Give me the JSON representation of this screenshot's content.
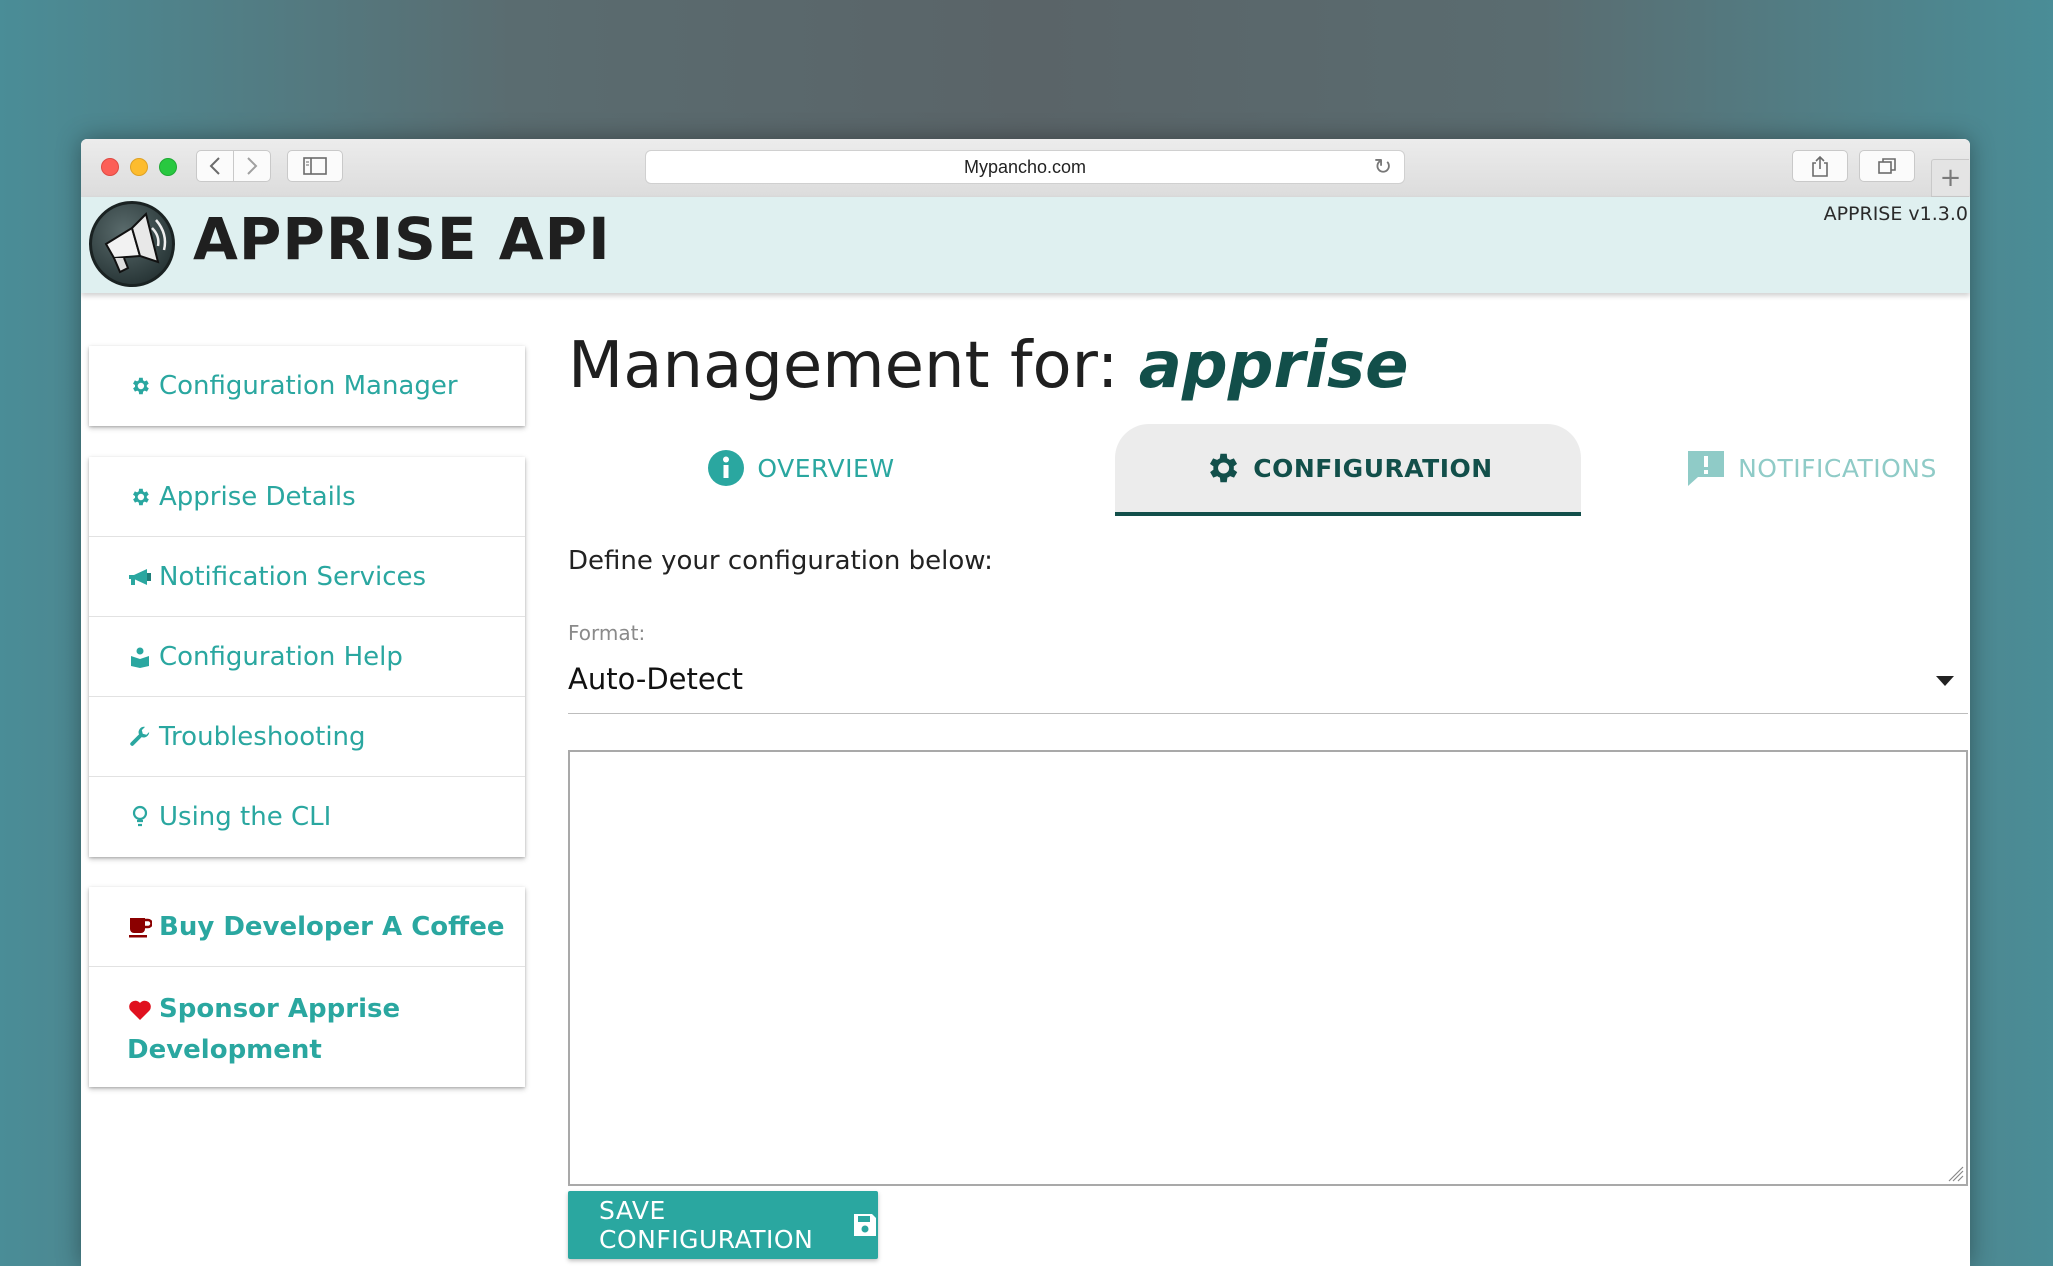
{
  "browser": {
    "url": "Mypancho.com"
  },
  "header": {
    "title": "APPRISE API",
    "version": "APPRISE v1.3.0"
  },
  "sidebar": {
    "top": {
      "label": "Configuration Manager",
      "icon": "gear-icon"
    },
    "items": [
      {
        "label": "Apprise Details",
        "icon": "gear-icon"
      },
      {
        "label": "Notification Services",
        "icon": "megaphone-icon"
      },
      {
        "label": "Configuration Help",
        "icon": "book-reader-icon"
      },
      {
        "label": "Troubleshooting",
        "icon": "wrench-icon"
      },
      {
        "label": "Using the CLI",
        "icon": "lightbulb-icon"
      }
    ],
    "support": [
      {
        "label": "Buy Developer A Coffee",
        "icon": "coffee-icon"
      },
      {
        "label_line1": "Sponsor Apprise",
        "label_line2": "Development",
        "icon": "heart-icon"
      }
    ]
  },
  "main": {
    "heading_prefix": "Management for:",
    "heading_key": "apprise",
    "tabs": [
      {
        "label": "OVERVIEW",
        "icon": "info-icon",
        "active": false
      },
      {
        "label": "CONFIGURATION",
        "icon": "gear-icon",
        "active": true
      },
      {
        "label": "NOTIFICATIONS",
        "icon": "alert-comment-icon",
        "active": false
      }
    ],
    "instruction": "Define your configuration below:",
    "format_label": "Format:",
    "format_value": "Auto-Detect",
    "config_text": "",
    "save_label": "SAVE CONFIGURATION"
  },
  "colors": {
    "accent": "#2aa7a0",
    "dark_accent": "#124f4a",
    "header_bg": "#dff0f0",
    "coffee": "#8b0000",
    "heart": "#e0111f"
  }
}
